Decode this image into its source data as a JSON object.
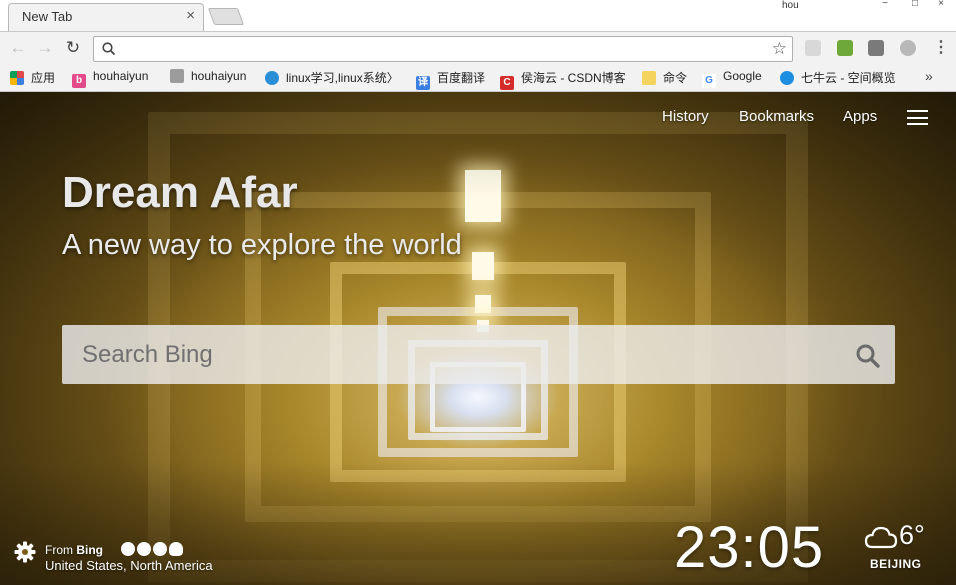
{
  "browser": {
    "tab": {
      "title": "New Tab",
      "close_label": "×"
    },
    "window": {
      "user_label": "hou",
      "minimize": "−",
      "maximize": "□",
      "close": "×"
    },
    "toolbar": {
      "back_glyph": "←",
      "forward_glyph": "→",
      "reload_glyph": "↻",
      "address_value": "",
      "star_glyph": "☆",
      "menu_glyph": "⋮",
      "extensions": [
        "extension-icon-1",
        "extension-icon-2",
        "extension-icon-3",
        "extension-icon-4"
      ]
    },
    "bookmarks": [
      {
        "label": "应用",
        "icon": "apps-grid-icon",
        "color": "#e04848"
      },
      {
        "label": "houhaiyun",
        "icon": "bookmark-b-icon",
        "color": "#e24a8a"
      },
      {
        "label": "houhaiyun",
        "icon": "bookmark-leaf-icon",
        "color": "#9c9c9c"
      },
      {
        "label": "linux学习,linux系统〉",
        "icon": "bookmark-globe-icon",
        "color": "#2b8fd8"
      },
      {
        "label": "百度翻译",
        "icon": "bookmark-translate-icon",
        "color": "#3d7fe0"
      },
      {
        "label": "侯海云 - CSDN博客",
        "icon": "bookmark-csdn-icon",
        "color": "#d42b2b"
      },
      {
        "label": "命令",
        "icon": "folder-icon",
        "color": "#f4d35e"
      },
      {
        "label": "Google",
        "icon": "google-icon",
        "color": "#4285f4"
      },
      {
        "label": "七牛云 - 空间概览",
        "icon": "bookmark-qiniu-icon",
        "color": "#1e8fe0"
      }
    ],
    "bookmarks_overflow": "»"
  },
  "page": {
    "nav": {
      "history": "History",
      "bookmarks": "Bookmarks",
      "apps": "Apps"
    },
    "title": "Dream Afar",
    "subtitle": "A new way to explore the world",
    "search": {
      "placeholder": "Search Bing",
      "value": ""
    },
    "credit": {
      "prefix": "From",
      "source": "Bing",
      "location": "United States, North America"
    },
    "clock": "23:05",
    "weather": {
      "temperature": "6°",
      "city": "BEIJING",
      "icon": "cloud-icon"
    },
    "colors": {
      "accent": "#ffffff",
      "search_bg": "#ebebeb"
    }
  }
}
